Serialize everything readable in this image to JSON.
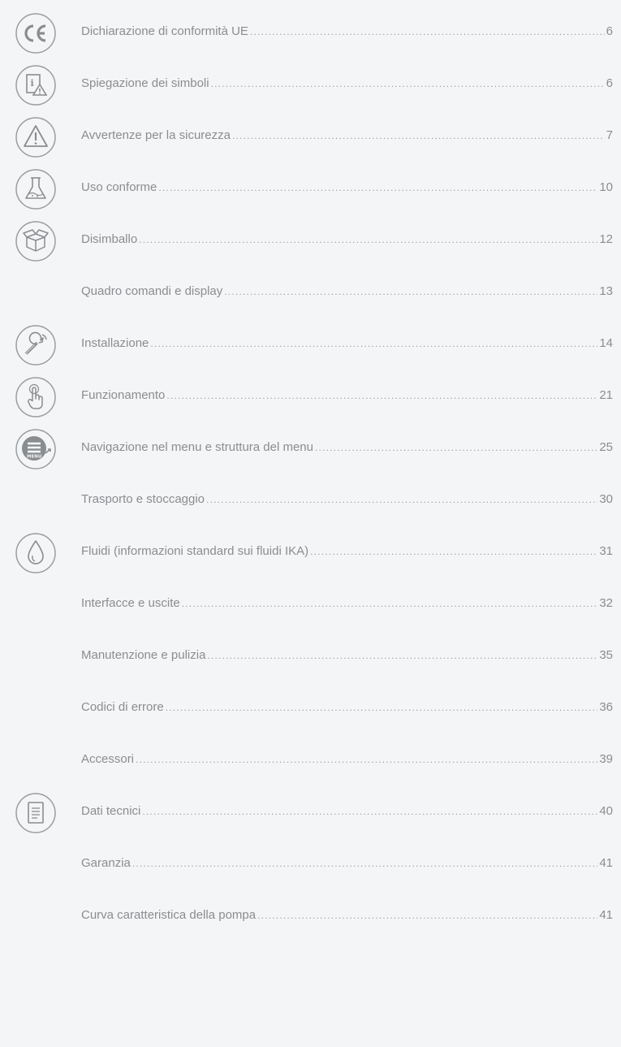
{
  "toc": [
    {
      "title": "Dichiarazione di conformità UE",
      "page": "6",
      "icon": "ce-mark-icon"
    },
    {
      "title": "Spiegazione dei simboli",
      "page": "6",
      "icon": "info-warning-icon"
    },
    {
      "title": "Avvertenze per la sicurezza",
      "page": "7",
      "icon": "warning-triangle-icon"
    },
    {
      "title": "Uso conforme",
      "page": "10",
      "icon": "flask-icon"
    },
    {
      "title": "Disimballo",
      "page": "12",
      "icon": "box-icon"
    },
    {
      "title": "Quadro comandi e display",
      "page": "13",
      "icon": null
    },
    {
      "title": "Installazione",
      "page": "14",
      "icon": "wrench-icon"
    },
    {
      "title": "Funzionamento",
      "page": "21",
      "icon": "touch-hand-icon"
    },
    {
      "title": "Navigazione nel menu e struttura del menu",
      "page": "25",
      "icon": "menu-icon",
      "icon_text": "MENU"
    },
    {
      "title": "Trasporto e stoccaggio",
      "page": "30",
      "icon": null
    },
    {
      "title": "Fluidi (informazioni standard sui fluidi IKA)",
      "page": "31",
      "icon": "drop-icon"
    },
    {
      "title": "Interfacce e uscite",
      "page": "32",
      "icon": null
    },
    {
      "title": "Manutenzione e pulizia",
      "page": "35",
      "icon": null
    },
    {
      "title": "Codici di errore",
      "page": "36",
      "icon": null
    },
    {
      "title": "Accessori",
      "page": "39",
      "icon": null
    },
    {
      "title": "Dati tecnici",
      "page": "40",
      "icon": "document-icon"
    },
    {
      "title": "Garanzia",
      "page": "41",
      "icon": null
    },
    {
      "title": "Curva caratteristica della pompa",
      "page": "41",
      "icon": null
    }
  ]
}
